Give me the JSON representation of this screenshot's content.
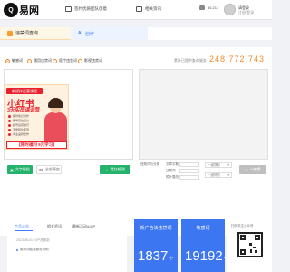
{
  "logo": {
    "mark": "Q",
    "name": "易网"
  },
  "header": {
    "nav": [
      "签约优质团队创意",
      "相关资讯"
    ],
    "user_count": "46,211",
    "username": "请登录",
    "user_sub": "注册/登录"
  },
  "tabs": [
    {
      "label": "违禁词查询"
    },
    {
      "label": "创作",
      "badge": "AI"
    }
  ],
  "modes": [
    {
      "label": "敏感词",
      "selected": true
    },
    {
      "label": "通用违禁词",
      "selected": false
    },
    {
      "label": "医疗违禁词",
      "selected": false
    },
    {
      "label": "影视违禁词",
      "selected": false
    }
  ],
  "counter": {
    "label": "累计已提供查询服务",
    "value": "248,772,743"
  },
  "ad": {
    "badge": "新媒体运营课程",
    "title": "小红书",
    "subtitle": "3天实战课训营",
    "points": [
      "爆款笔记创作",
      "账号定位设计",
      "起号运营技巧",
      "流量转化变现",
      "商业品牌合作"
    ],
    "cta": "【限时福利 9元学习】"
  },
  "actions": {
    "paste": "文字粘贴",
    "clear": "全部清空",
    "check": "提交检测",
    "check_result": "违规词与分类",
    "fields": [
      "文章字数",
      "违禁词",
      "预计整改"
    ],
    "select1": "一键提取",
    "select2": "一键修改",
    "one_click": "AI编辑"
  },
  "bottom": {
    "tabs": [
      "产品公告",
      "相关资讯",
      "最新活动&VIP"
    ],
    "date": "2023-08-01 24产品更新",
    "item": "更新功能及服务说明",
    "stats": [
      {
        "label": "新广告法违禁词",
        "value": "1837",
        "unit": "个"
      },
      {
        "label": "敏感词",
        "value": "19192",
        "unit": "个"
      }
    ],
    "qr_label": "扫码关注公众号"
  },
  "colors": {
    "accent": "#f08c2a",
    "brand_blue": "#3c76f0",
    "ad_red": "#e8212e",
    "green": "#23b36b"
  }
}
